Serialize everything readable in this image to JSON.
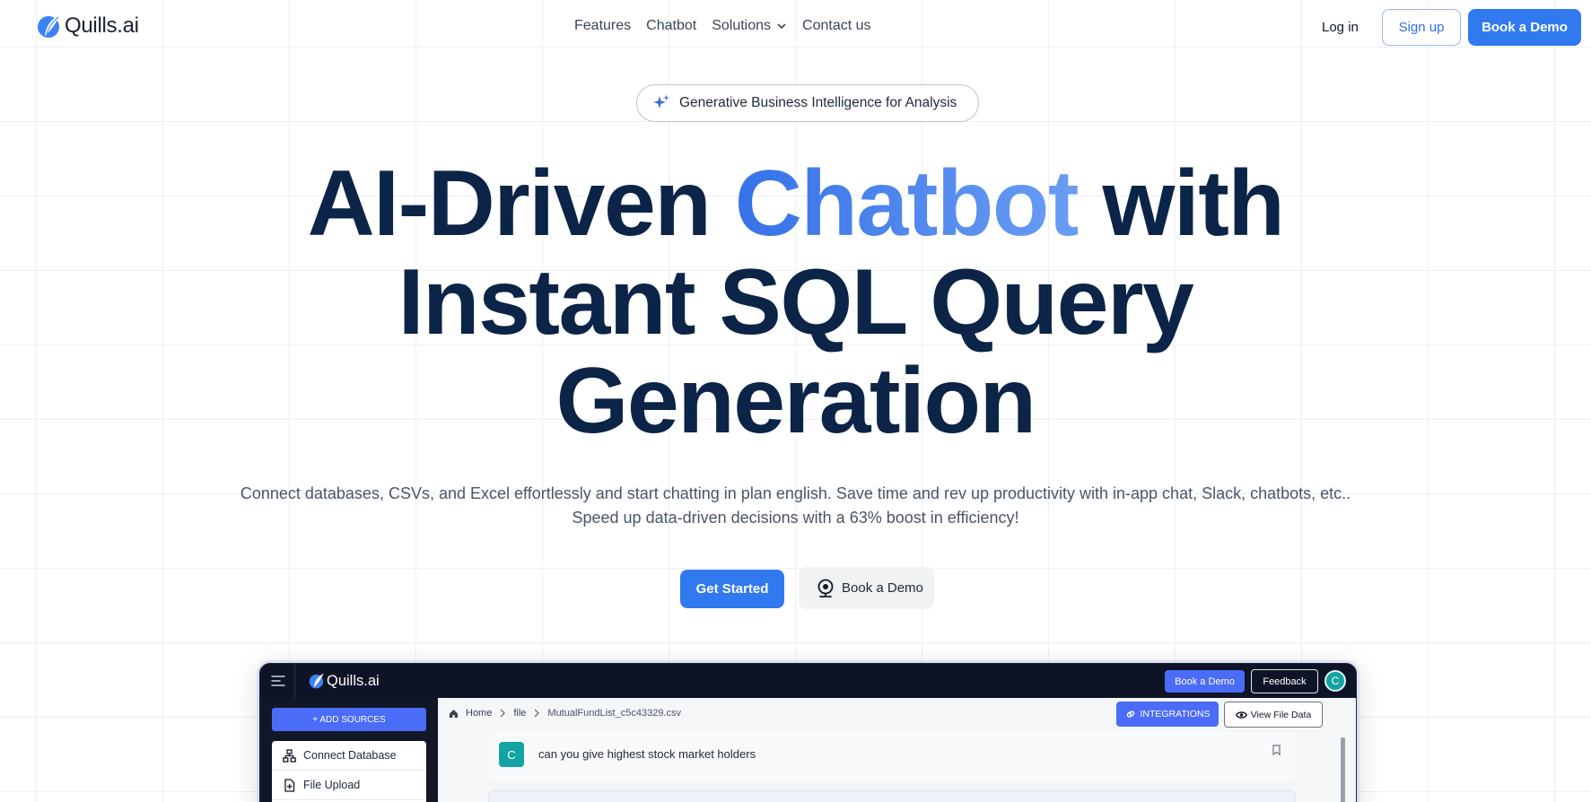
{
  "nav": {
    "logo_text": "Quills.ai",
    "links": [
      "Features",
      "Chatbot",
      "Solutions",
      "Contact us"
    ],
    "login": "Log in",
    "signup": "Sign up",
    "book_demo": "Book a Demo"
  },
  "hero": {
    "pill_text": "Generative Business Intelligence for Analysis",
    "headline_part1": "AI-Driven ",
    "headline_accent": "Chatbot",
    "headline_part2": " with",
    "headline_line2": "Instant SQL Query",
    "headline_line3": "Generation",
    "subtext": "Connect databases, CSVs, and Excel effortlessly and start chatting in plan english. Save time and rev up productivity with in-app chat, Slack, chatbots, etc.. Speed up data-driven decisions with a 63% boost in efficiency!",
    "cta_primary": "Get Started",
    "cta_secondary": "Book a Demo"
  },
  "app_preview": {
    "logo_text": "Quills.ai",
    "book_demo": "Book a Demo",
    "feedback": "Feedback",
    "avatar_initial": "C",
    "add_sources": "+ ADD SOURCES",
    "sidebar_items": [
      "Connect Database",
      "File Upload"
    ],
    "breadcrumbs": [
      "Home",
      "file",
      "MutualFundList_c5c43329.csv"
    ],
    "integrations": "INTEGRATIONS",
    "view_file_data": "View File Data",
    "chat_avatar": "C",
    "chat_message": "can you give highest stock market holders"
  },
  "colors": {
    "primary": "#3079ef",
    "heading": "#0b2447",
    "accent_gradient_start": "#3672e8",
    "accent_gradient_end": "#6a9df3",
    "app_dark": "#0f1326",
    "app_button": "#4a6cf7",
    "avatar_teal": "#14a3a3"
  },
  "icons": [
    "quill-logo-icon",
    "chevron-down-icon",
    "sparkle-icon",
    "webcam-icon",
    "hamburger-icon",
    "database-icon",
    "file-upload-icon",
    "home-icon",
    "chevron-right-icon",
    "link-icon",
    "eye-icon",
    "bookmark-icon"
  ]
}
